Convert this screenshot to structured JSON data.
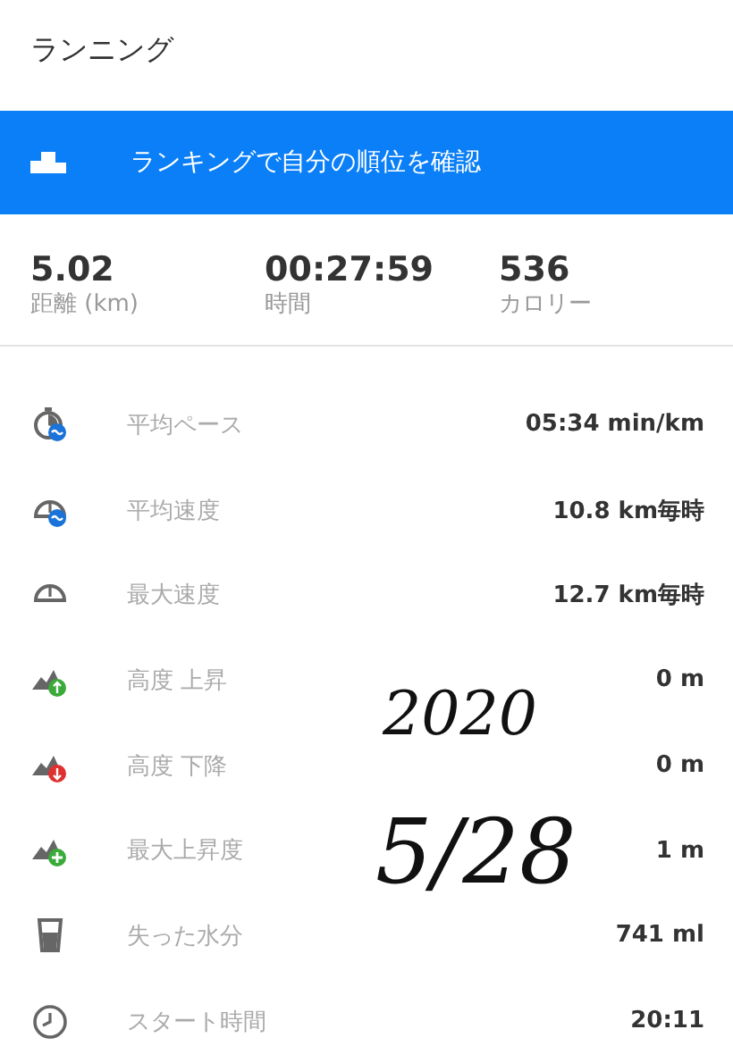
{
  "title": "ランニング",
  "banner": {
    "text": "ランキングで自分の順位を確認"
  },
  "summary": [
    {
      "value": "5.02",
      "label": "距離 (km)"
    },
    {
      "value": "00:27:59",
      "label": "時間"
    },
    {
      "value": "536",
      "label": "カロリー"
    }
  ],
  "stats": [
    {
      "kind": "pace",
      "label": "平均ペース",
      "value": "05:34 min/km"
    },
    {
      "kind": "speed",
      "label": "平均速度",
      "value": "10.8 km毎時"
    },
    {
      "kind": "max_speed",
      "label": "最大速度",
      "value": "12.7 km毎時"
    },
    {
      "kind": "ascent",
      "label": "高度 上昇",
      "value": "0 m"
    },
    {
      "kind": "descent",
      "label": "高度 下降",
      "value": "0 m"
    },
    {
      "kind": "max_ascent",
      "label": "最大上昇度",
      "value": "1 m"
    },
    {
      "kind": "water",
      "label": "失った水分",
      "value": "741 ml"
    },
    {
      "kind": "clock",
      "label": "スタート時間",
      "value": "20:11"
    }
  ],
  "handwritten_note": [
    "2020",
    "5/28"
  ]
}
